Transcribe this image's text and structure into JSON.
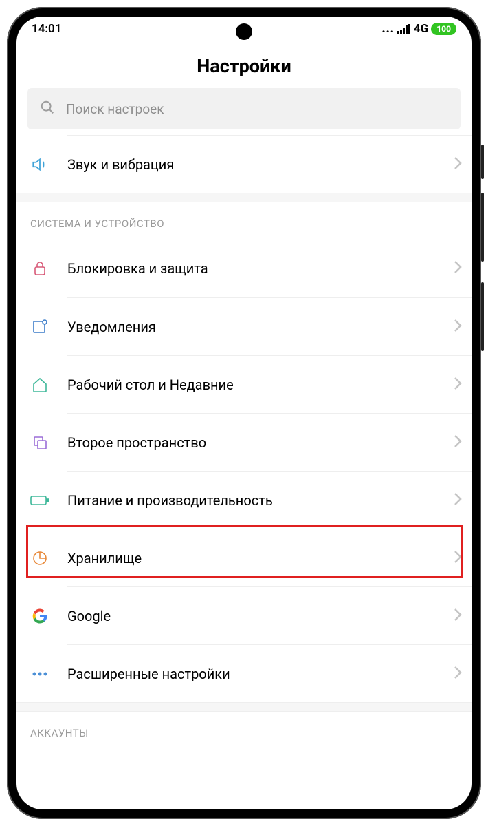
{
  "status": {
    "time": "14:01",
    "network": "4G",
    "battery": "100"
  },
  "title": "Настройки",
  "search": {
    "placeholder": "Поиск настроек"
  },
  "sections": {
    "first": {
      "items": [
        {
          "label": "Звук и вибрация"
        }
      ]
    },
    "system": {
      "header": "СИСТЕМА И УСТРОЙСТВО",
      "items": [
        {
          "label": "Блокировка и защита"
        },
        {
          "label": "Уведомления"
        },
        {
          "label": "Рабочий стол и Недавние"
        },
        {
          "label": "Второе пространство"
        },
        {
          "label": "Питание и производительность"
        },
        {
          "label": "Хранилище"
        },
        {
          "label": "Google"
        },
        {
          "label": "Расширенные настройки"
        }
      ]
    },
    "accounts": {
      "header": "АККАУНТЫ"
    }
  },
  "colors": {
    "highlight": "#e02020",
    "battery": "#31c421"
  }
}
